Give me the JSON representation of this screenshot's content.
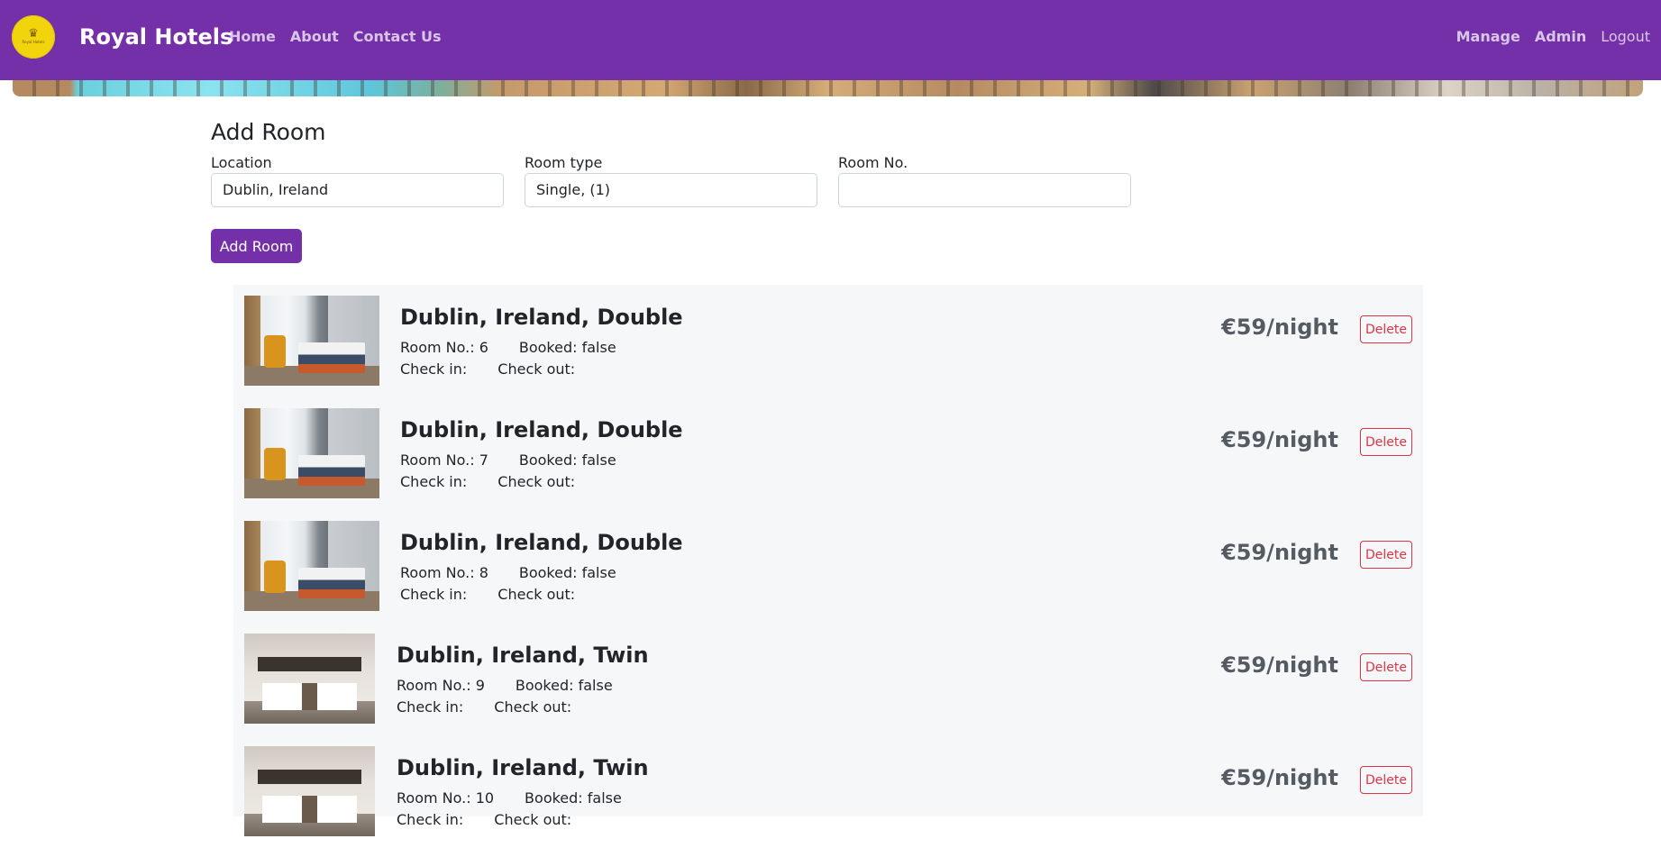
{
  "navbar": {
    "brand": "Royal Hotels",
    "logo_text": "Royal Hotels",
    "left_links": [
      "Home",
      "About",
      "Contact Us"
    ],
    "right_links": [
      "Manage",
      "Admin",
      "Logout"
    ]
  },
  "add_room": {
    "title": "Add Room",
    "location_label": "Location",
    "location_value": "Dublin, Ireland",
    "room_type_label": "Room type",
    "room_type_value": "Single, (1)",
    "room_no_label": "Room No.",
    "room_no_value": "",
    "submit_label": "Add Room"
  },
  "rooms": [
    {
      "title": "Dublin, Ireland, Double",
      "room_no": "Room No.: 6",
      "booked": "Booked: false",
      "check_in": "Check in:",
      "check_out": "Check out:",
      "price": "€59/night",
      "delete": "Delete"
    },
    {
      "title": "Dublin, Ireland, Double",
      "room_no": "Room No.: 7",
      "booked": "Booked: false",
      "check_in": "Check in:",
      "check_out": "Check out:",
      "price": "€59/night",
      "delete": "Delete"
    },
    {
      "title": "Dublin, Ireland, Double",
      "room_no": "Room No.: 8",
      "booked": "Booked: false",
      "check_in": "Check in:",
      "check_out": "Check out:",
      "price": "€59/night",
      "delete": "Delete"
    },
    {
      "title": "Dublin, Ireland, Twin",
      "room_no": "Room No.: 9",
      "booked": "Booked: false",
      "check_in": "Check in:",
      "check_out": "Check out:",
      "price": "€59/night",
      "delete": "Delete"
    },
    {
      "title": "Dublin, Ireland, Twin",
      "room_no": "Room No.: 10",
      "booked": "Booked: false",
      "check_in": "Check in:",
      "check_out": "Check out:",
      "price": "€59/night",
      "delete": "Delete"
    }
  ],
  "colors": {
    "brand_purple": "#7430a8",
    "logo_yellow": "#f2d40c",
    "danger": "#dc3545"
  }
}
